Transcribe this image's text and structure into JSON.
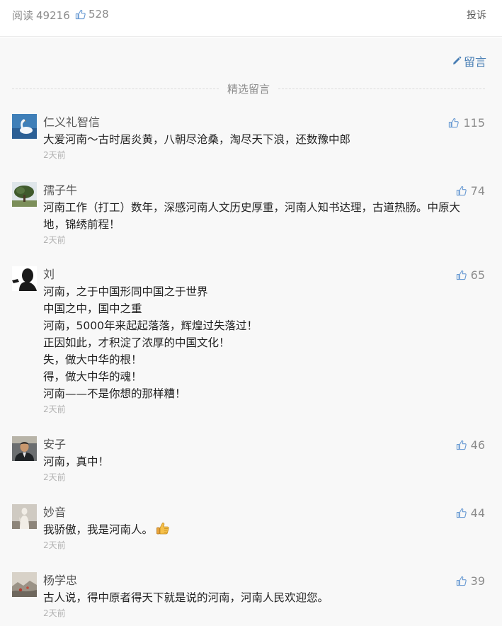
{
  "stats": {
    "read_label": "阅读",
    "read_count": "49216",
    "like_count": "528",
    "report_label": "投诉"
  },
  "write_label": "留言",
  "section_title": "精选留言",
  "colors": {
    "link_blue": "#4a7fb5",
    "gray_text": "#8c8c8c",
    "time_gray": "#b2b2b2"
  },
  "comments": [
    {
      "nick": "仁义礼智信",
      "lines": [
        "大爱河南～古时居炎黄，八朝尽沧桑，淘尽天下浪，还数豫中郎"
      ],
      "time": "2天前",
      "likes": "115",
      "avatar": "swan-avatar"
    },
    {
      "nick": "孺子牛",
      "lines": [
        "河南工作（打工）数年，深感河南人文历史厚重，河南人知书达理，古道热肠。中原大",
        "地，锦绣前程！"
      ],
      "time": "2天前",
      "likes": "74",
      "avatar": "tree-avatar"
    },
    {
      "nick": "刘",
      "lines": [
        "河南，之于中国形同中国之于世界",
        "中国之中，国中之重",
        "河南，5000年来起起落落，辉煌过失落过！",
        "正因如此，才积淀了浓厚的中国文化！",
        "失，做大中华的根！",
        "得，做大中华的魂！",
        "河南——不是你想的那样糟！"
      ],
      "time": "2天前",
      "likes": "65",
      "avatar": "silhouette-avatar"
    },
    {
      "nick": "安子",
      "lines": [
        "河南，真中！"
      ],
      "time": "2天前",
      "likes": "46",
      "avatar": "man-avatar"
    },
    {
      "nick": "妙音",
      "lines": [
        "我骄傲，我是河南人。"
      ],
      "time": "2天前",
      "likes": "44",
      "avatar": "statue-avatar",
      "emoji": "thumbs-up-emoji"
    },
    {
      "nick": "杨学忠",
      "lines": [
        "古人说，得中原者得天下就是说的河南，河南人民欢迎您。"
      ],
      "time": "2天前",
      "likes": "39",
      "avatar": "landscape-avatar"
    }
  ]
}
